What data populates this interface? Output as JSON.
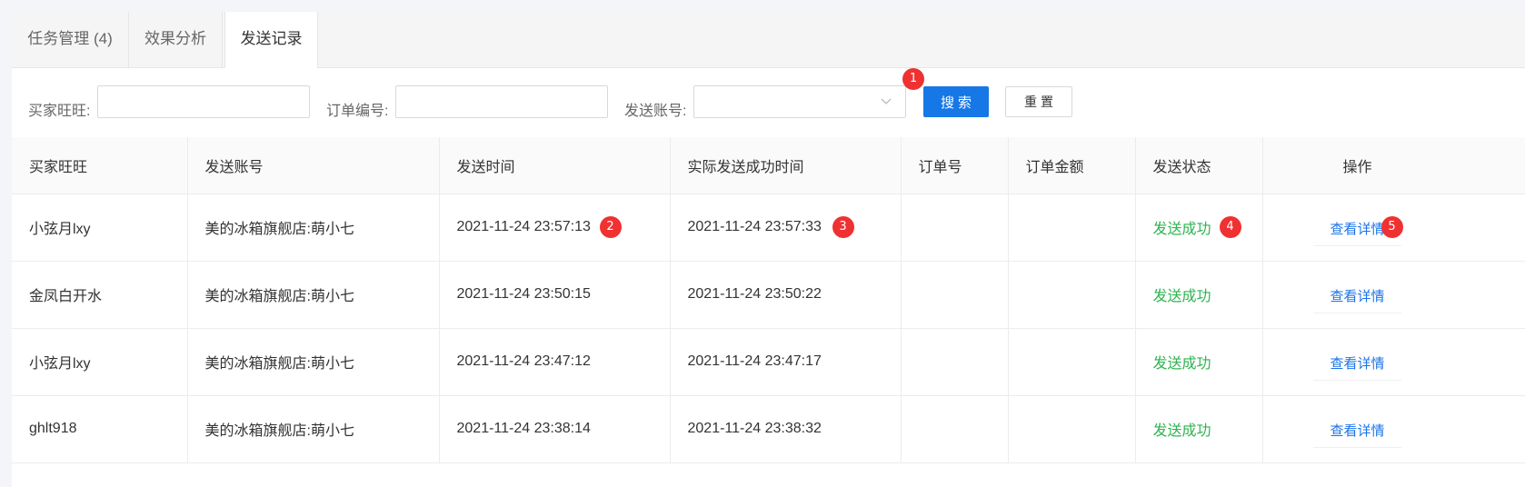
{
  "tabs": [
    {
      "label": "任务管理 (4)"
    },
    {
      "label": "效果分析"
    },
    {
      "label": "发送记录"
    }
  ],
  "filters": {
    "buyer_label": "买家旺旺:",
    "buyer_value": "",
    "order_label": "订单编号:",
    "order_value": "",
    "account_label": "发送账号:",
    "account_value": "",
    "search_label": "搜索",
    "reset_label": "重置"
  },
  "badges": [
    "1",
    "2",
    "3",
    "4",
    "5"
  ],
  "table": {
    "headers": [
      "买家旺旺",
      "发送账号",
      "发送时间",
      "实际发送成功时间",
      "订单号",
      "订单金额",
      "发送状态",
      "操作"
    ],
    "rows": [
      {
        "buyer": "小弦月lxy",
        "account": "美的冰箱旗舰店:萌小七",
        "send_time": "2021-11-24 23:57:13",
        "success_time": "2021-11-24 23:57:33",
        "order_no": "",
        "amount": "",
        "status": "发送成功",
        "action": "查看详情"
      },
      {
        "buyer": "金凤白开水",
        "account": "美的冰箱旗舰店:萌小七",
        "send_time": "2021-11-24 23:50:15",
        "success_time": "2021-11-24 23:50:22",
        "order_no": "",
        "amount": "",
        "status": "发送成功",
        "action": "查看详情"
      },
      {
        "buyer": "小弦月lxy",
        "account": "美的冰箱旗舰店:萌小七",
        "send_time": "2021-11-24 23:47:12",
        "success_time": "2021-11-24 23:47:17",
        "order_no": "",
        "amount": "",
        "status": "发送成功",
        "action": "查看详情"
      },
      {
        "buyer": "ghlt918",
        "account": "美的冰箱旗舰店:萌小七",
        "send_time": "2021-11-24 23:38:14",
        "success_time": "2021-11-24 23:38:32",
        "order_no": "",
        "amount": "",
        "status": "发送成功",
        "action": "查看详情"
      }
    ]
  },
  "colors": {
    "primary": "#1677e6",
    "success": "#2eb34f",
    "link": "#1a73e8",
    "badge": "#ef3131"
  },
  "icons": {
    "select_arrow": "chevron-down-icon"
  }
}
